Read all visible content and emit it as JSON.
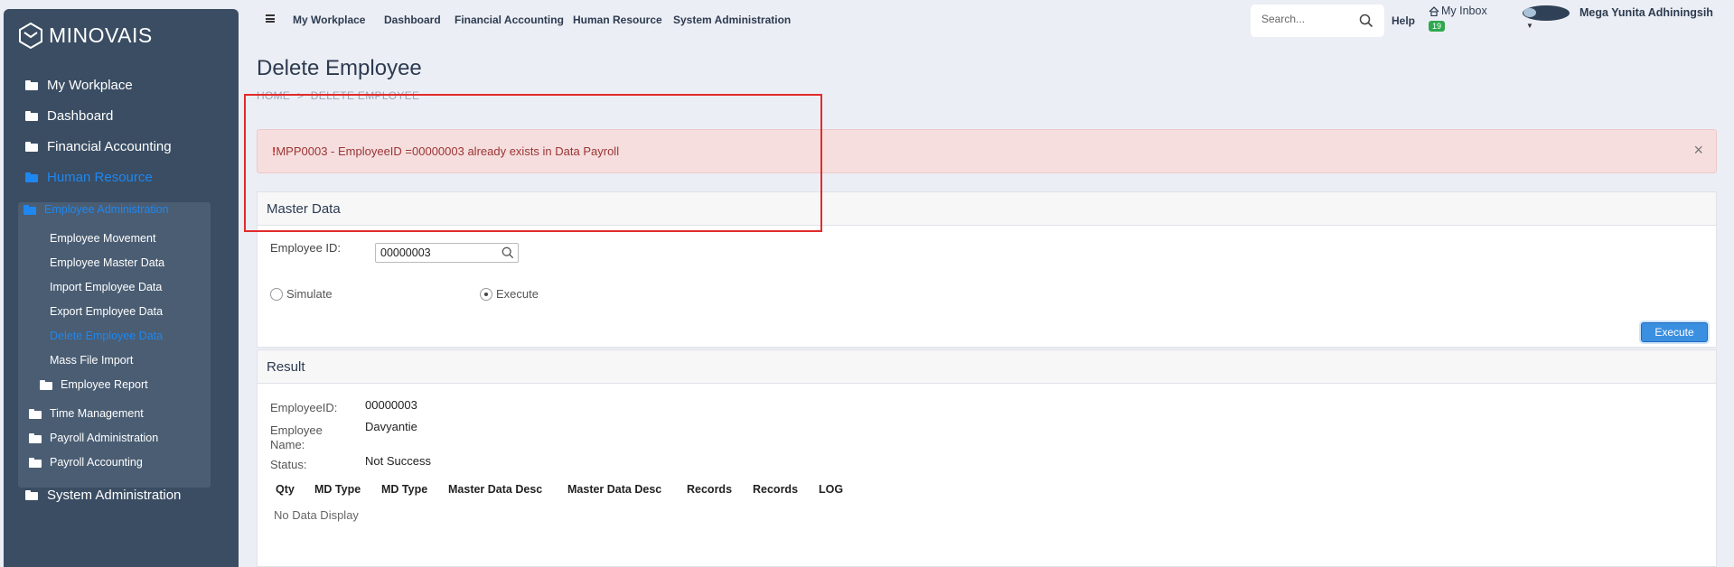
{
  "app": {
    "logo_text": "MINOVAIS"
  },
  "sidebar": {
    "items": [
      {
        "label": "My Workplace"
      },
      {
        "label": "Dashboard"
      },
      {
        "label": "Financial Accounting"
      },
      {
        "label": "Human Resource"
      },
      {
        "label": "System Administration"
      }
    ],
    "hr_group": {
      "label": "Employee Administration",
      "children": [
        {
          "label": "Employee Movement"
        },
        {
          "label": "Employee Master Data"
        },
        {
          "label": "Import Employee Data"
        },
        {
          "label": "Export Employee Data"
        },
        {
          "label": "Delete Employee Data"
        },
        {
          "label": "Mass File Import"
        },
        {
          "label": "Employee Report"
        }
      ],
      "siblings": [
        {
          "label": "Time Management"
        },
        {
          "label": "Payroll Administration"
        },
        {
          "label": "Payroll Accounting"
        }
      ]
    }
  },
  "topbar": {
    "links": [
      "My Workplace",
      "Dashboard",
      "Financial Accounting",
      "Human Resource",
      "System Administration"
    ],
    "search_placeholder": "Search...",
    "help": "Help",
    "inbox_label": "My Inbox",
    "inbox_count": "19",
    "user_name": "Mega Yunita Adhiningsih"
  },
  "page": {
    "title": "Delete Employee",
    "breadcrumb": [
      "HOME",
      ">",
      "DELETE EMPLOYEE"
    ]
  },
  "alert": {
    "mark": "!",
    "message": "MPP0003 - EmployeeID =00000003 already exists in Data Payroll",
    "close": "×"
  },
  "master": {
    "header": "Master Data",
    "employee_id_label": "Employee ID:",
    "employee_id_value": "00000003",
    "radio_simulate": "Simulate",
    "radio_execute": "Execute",
    "execute_button": "Execute"
  },
  "result": {
    "header": "Result",
    "employee_id_label": "EmployeeID:",
    "employee_id_value": "00000003",
    "employee_name_label_1": "Employee",
    "employee_name_label_2": "Name:",
    "employee_name_value": "Davyantie",
    "status_label": "Status:",
    "status_value": "Not Success",
    "columns": [
      "Qty",
      "MD Type",
      "MD Type",
      "Master Data Desc",
      "Master Data Desc",
      "Records",
      "Records",
      "LOG"
    ],
    "empty_text": "No Data Display"
  },
  "colors": {
    "sidebar": "#3a4d63",
    "accent": "#1e87f0",
    "alert_bg": "#f6dede",
    "alert_text": "#9b3434",
    "highlight": "#e12b2b"
  }
}
